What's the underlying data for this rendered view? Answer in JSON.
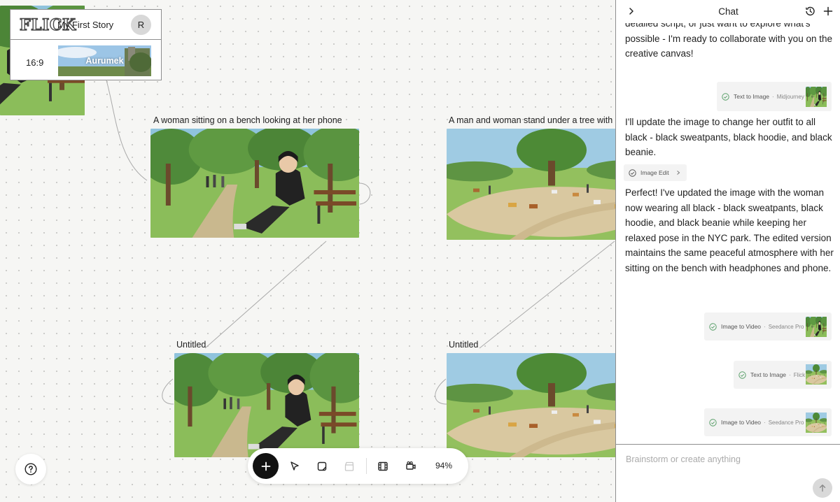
{
  "project": {
    "logo_text": "FLICK",
    "story_title": "My First Story",
    "avatar_initial": "R",
    "aspect_ratio": "16:9",
    "style_name": "Aurumek"
  },
  "canvas": {
    "frames": [
      {
        "title": "A woman sitting on a bench looking at her phone",
        "image_icon": "park-bench-woman-image"
      },
      {
        "title": "A man and woman stand under a tree with a g",
        "image_icon": "park-dogs-tree-image"
      },
      {
        "title": "Untitled",
        "image_icon": "park-bench-woman-image"
      },
      {
        "title": "Untitled",
        "image_icon": "park-dogs-tree-image"
      }
    ]
  },
  "toolbar": {
    "tools": [
      "add-icon",
      "cursor-icon",
      "note-icon",
      "clapperboard-icon",
      "film-icon",
      "camera-icon"
    ],
    "zoom": "94%"
  },
  "chat": {
    "title": "Chat",
    "messages": [
      "detailed script, or just want to explore what's possible - I'm ready to collaborate with you on the creative canvas!",
      "I'll update the image to change her outfit to all black - black sweatpants, black hoodie, and black beanie.",
      "Perfect! I've updated the image with the woman now wearing all black - black sweatpants, black hoodie, and black beanie while keeping her relaxed pose in the NYC park. The edited version maintains the same peaceful atmosphere with her sitting on the bench with headphones and phone."
    ],
    "tool_chips": [
      {
        "label": "Text to Image",
        "model": "Midjourney"
      },
      {
        "label": "Image Edit"
      },
      {
        "label": "Image to Video",
        "model": "Seedance Pro"
      },
      {
        "label": "Text to Image",
        "model": "Flick"
      },
      {
        "label": "Image to Video",
        "model": "Seedance Pro"
      }
    ],
    "input_placeholder": "Brainstorm or create anything"
  },
  "colors": {
    "accent_check": "#5aa06a",
    "border": "#8e8e8e",
    "toolbar_add_bg": "#111111"
  }
}
